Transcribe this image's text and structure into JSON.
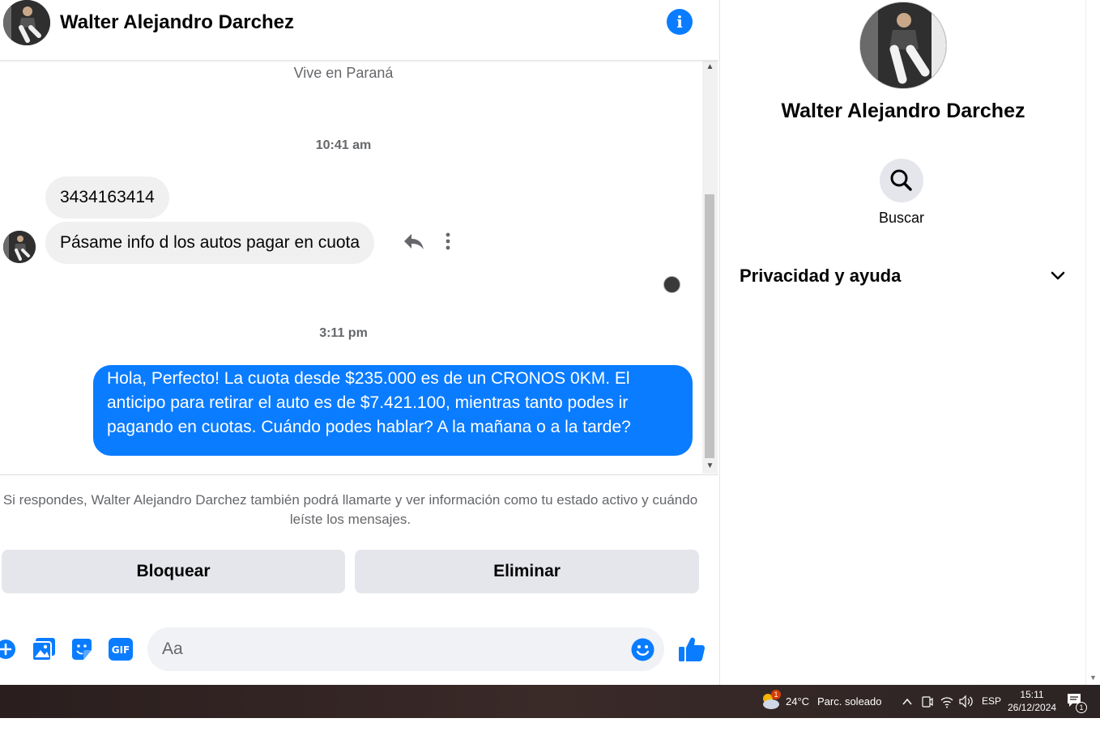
{
  "header": {
    "name": "Walter Alejandro Darchez"
  },
  "conversation": {
    "lives_in": "Vive en Paraná",
    "time1": "10:41 am",
    "msg_phone": "3434163414",
    "msg_request": "Pásame info d los autos pagar en cuota",
    "time2": "3:11 pm",
    "msg_reply": "Hola, Perfecto! La cuota desde $235.000 es de un CRONOS 0KM. El anticipo para retirar el auto es de $7.421.100, mientras tanto podes ir pagando en cuotas. Cuándo podes hablar? A la mañana o a la tarde?"
  },
  "notice": "Si respondes, Walter Alejandro Darchez también podrá llamarte y ver información como tu estado activo y cuándo leíste los mensajes.",
  "buttons": {
    "block": "Bloquear",
    "delete": "Eliminar"
  },
  "composer": {
    "placeholder": "Aa",
    "gif": "GIF"
  },
  "sidebar": {
    "name": "Walter Alejandro Darchez",
    "search_label": "Buscar",
    "privacy_label": "Privacidad y ayuda"
  },
  "taskbar": {
    "weather_badge": "1",
    "temperature": "24°C",
    "weather": "Parc. soleado",
    "language": "ESP",
    "time": "15:11",
    "date": "26/12/2024",
    "notif_count": "1"
  },
  "colors": {
    "accent": "#0a7cff",
    "bubble_in": "#f0f0f0",
    "button_bg": "#e4e6eb"
  }
}
